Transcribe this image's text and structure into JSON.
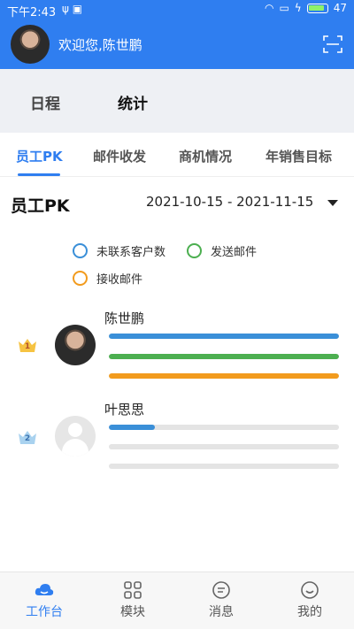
{
  "status_bar": {
    "time": "下午2:43",
    "battery": "47"
  },
  "header": {
    "welcome": "欢迎您,陈世鹏"
  },
  "subtabs": [
    {
      "label": "日程",
      "active": false
    },
    {
      "label": "统计",
      "active": true
    }
  ],
  "tabs": [
    {
      "label": "员工PK",
      "active": true
    },
    {
      "label": "邮件收发",
      "active": false
    },
    {
      "label": "商机情况",
      "active": false
    },
    {
      "label": "年销售目标",
      "active": false
    }
  ],
  "pk": {
    "title": "员工PK",
    "date_range": "2021-10-15 - 2021-11-15",
    "legend": [
      {
        "label": "未联系客户数",
        "color": "#3a8fd8"
      },
      {
        "label": "发送邮件",
        "color": "#4caf50"
      },
      {
        "label": "接收邮件",
        "color": "#f29b1d"
      }
    ],
    "rankings": [
      {
        "rank": "1",
        "name": "陈世鹏",
        "values": [
          1.0,
          1.0,
          1.0
        ]
      },
      {
        "rank": "2",
        "name": "叶思思",
        "values": [
          0.2,
          0.0,
          0.0
        ]
      }
    ]
  },
  "bottom_nav": [
    {
      "label": "工作台",
      "active": true
    },
    {
      "label": "模块",
      "active": false
    },
    {
      "label": "消息",
      "active": false
    },
    {
      "label": "我的",
      "active": false
    }
  ],
  "colors": {
    "primary": "#2f7ef0",
    "track": "#e4e4e4"
  }
}
